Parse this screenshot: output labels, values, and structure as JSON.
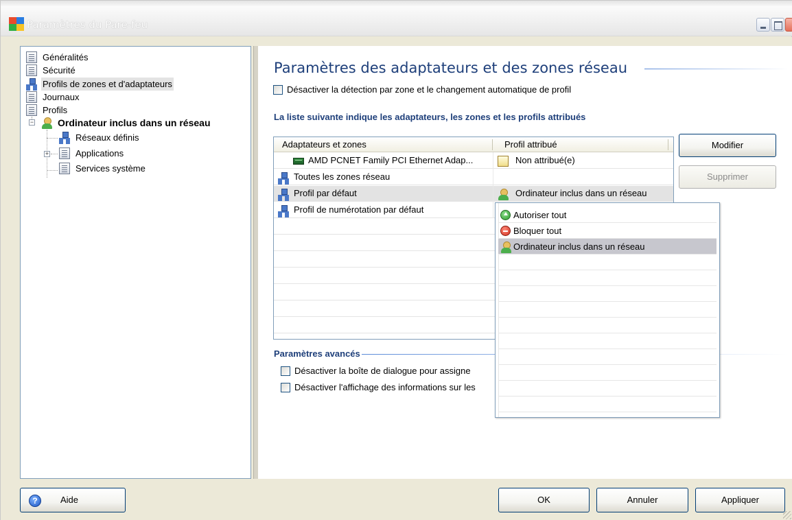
{
  "window": {
    "title": "Paramètres du Pare-feu"
  },
  "tree": {
    "items": [
      {
        "label": "Généralités"
      },
      {
        "label": "Sécurité"
      },
      {
        "label": "Profils de zones et d'adaptateurs"
      },
      {
        "label": "Journaux"
      },
      {
        "label": "Profils"
      },
      {
        "label": "Ordinateur inclus dans un réseau"
      },
      {
        "label": "Réseaux définis"
      },
      {
        "label": "Applications"
      },
      {
        "label": "Services système"
      }
    ]
  },
  "content": {
    "heading": "Paramètres des adaptateurs et des zones réseau",
    "disable_detection_label": "Désactiver la détection par zone et le changement automatique de profil",
    "list_title": "La liste suivante indique les adaptateurs, les zones et les profils attribués",
    "columns": [
      "Adaptateurs et zones",
      "Profil attribué"
    ],
    "rows": [
      {
        "name": "AMD PCNET Family PCI Ethernet Adap...",
        "profile": "Non attribué(e)"
      },
      {
        "name": "Toutes les zones réseau",
        "profile": ""
      },
      {
        "name": "Profil par défaut",
        "profile": "Ordinateur inclus dans un réseau"
      },
      {
        "name": "Profil de numérotation par défaut",
        "profile": ""
      }
    ],
    "modify_button": "Modifier",
    "delete_button": "Supprimer",
    "advanced_title": "Paramètres avancés",
    "advanced_options": [
      "Désactiver la boîte de dialogue pour assigne",
      "Désactiver l'affichage des informations sur les"
    ]
  },
  "dropdown": {
    "options": [
      {
        "label": "Autoriser tout",
        "icon": "allow-all-icon"
      },
      {
        "label": "Bloquer tout",
        "icon": "block-all-icon"
      },
      {
        "label": "Ordinateur inclus dans un réseau",
        "icon": "user-icon"
      }
    ],
    "selected": "Ordinateur inclus dans un réseau"
  },
  "footer": {
    "help_button": "Aide",
    "ok_button": "OK",
    "cancel_button": "Annuler",
    "apply_button": "Appliquer"
  },
  "colors": {
    "heading": "#1e3f7a",
    "selection": "#e3e3e3",
    "dropdown_selection": "#c7c7ce"
  }
}
